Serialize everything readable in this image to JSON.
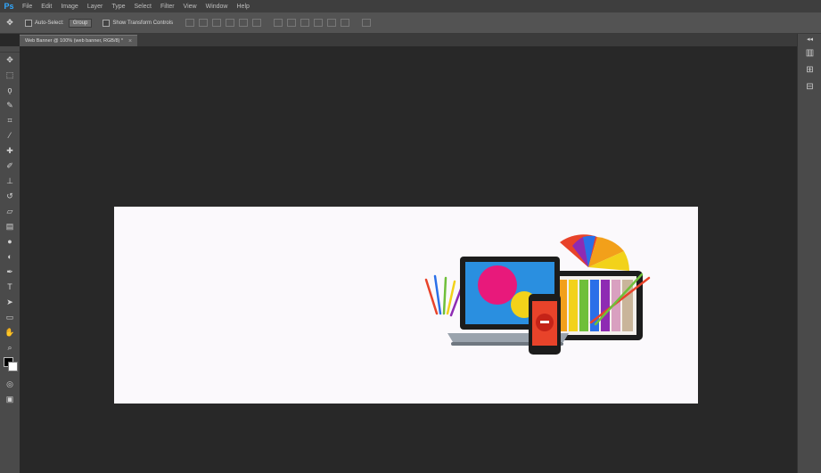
{
  "app": {
    "logo": "Ps"
  },
  "menu": {
    "items": [
      "File",
      "Edit",
      "Image",
      "Layer",
      "Type",
      "Select",
      "Filter",
      "View",
      "Window",
      "Help"
    ]
  },
  "options_bar": {
    "tool_icon": "move-tool-icon",
    "auto_select_label": "Auto-Select:",
    "auto_select_value": "Group",
    "transform_controls_label": "Show Transform Controls"
  },
  "document": {
    "tab_title": "Web Banner @ 100% (web banner, RGB/8) *",
    "close_glyph": "×"
  },
  "canvas": {
    "background_color": "#fbf9fc",
    "workspace_color": "#282828"
  },
  "colors": {
    "foreground": "#000000",
    "background": "#ffffff",
    "accent_magenta": "#e8197b",
    "accent_yellow": "#f2d21a",
    "accent_red": "#e8432a"
  }
}
